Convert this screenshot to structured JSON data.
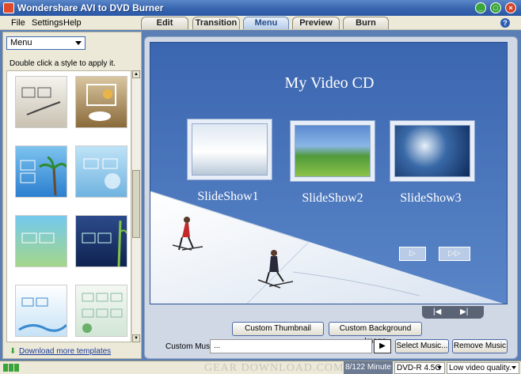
{
  "window": {
    "title": "Wondershare AVI to DVD Burner",
    "minimize": "_",
    "maximize": "□",
    "close": "×"
  },
  "menu": {
    "file": "File",
    "settings": "Settings",
    "help": "Help"
  },
  "tabs": [
    {
      "label": "Edit",
      "active": false
    },
    {
      "label": "Transition",
      "active": false
    },
    {
      "label": "Menu",
      "active": true
    },
    {
      "label": "Preview",
      "active": false
    },
    {
      "label": "Burn",
      "active": false
    }
  ],
  "help_icon": "?",
  "left_panel": {
    "select_value": "Menu",
    "hint": "Double click a style to apply it.",
    "download_link": "Download more templates",
    "templates": [
      {
        "name": "template-frames-brown"
      },
      {
        "name": "template-cups"
      },
      {
        "name": "template-beach-palm"
      },
      {
        "name": "template-blue-abstract"
      },
      {
        "name": "template-green-frames"
      },
      {
        "name": "template-bamboo-dark"
      },
      {
        "name": "template-blue-stars"
      },
      {
        "name": "template-grid-film"
      }
    ]
  },
  "preview": {
    "menu_title": "My Video CD",
    "slideshows": [
      {
        "label": "SlideShow1"
      },
      {
        "label": "SlideShow2"
      },
      {
        "label": "SlideShow3"
      }
    ],
    "nav_next": "▷",
    "nav_last": "▷▷",
    "pager_first": "|◀",
    "pager_last": "▶|"
  },
  "controls": {
    "custom_thumbnail": "Custom Thumbnail",
    "custom_background": "Custom Background Image",
    "custom_music_label": "Custom Music :",
    "custom_music_value": "...",
    "play": "▶",
    "select_music": "Select Music...",
    "remove_music": "Remove Music"
  },
  "status": {
    "watermark": "GEAR DOWNLOAD.COM",
    "capacity": "8/122 Minute",
    "disc_type": "DVD-R 4.5G",
    "quality": "Low video quality."
  },
  "colors": {
    "accent": "#3d6ab4",
    "titlebar": "#2a58a5",
    "panel_bg": "#ece9d8"
  }
}
